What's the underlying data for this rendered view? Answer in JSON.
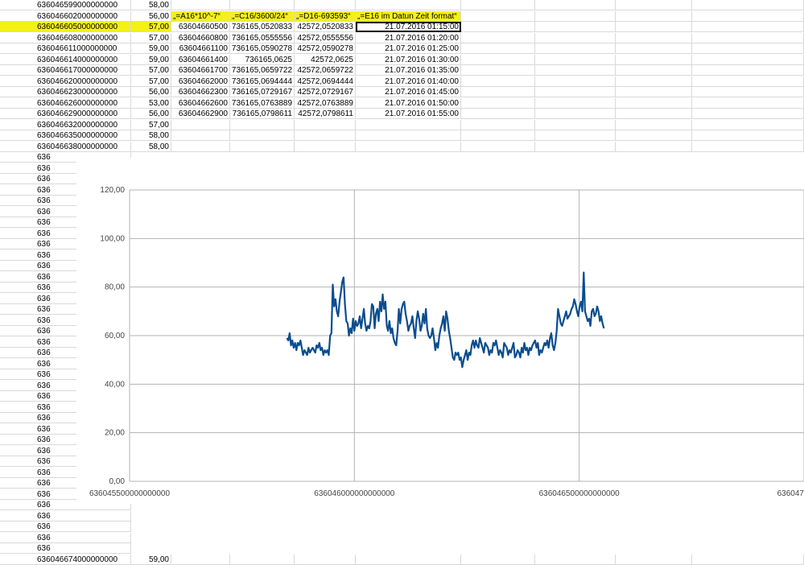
{
  "sheet": {
    "rows": [
      {
        "a": "636046599000000000",
        "b": "58,00"
      },
      {
        "a": "636046602000000000",
        "b": "56,00",
        "c": "„=A16*10^-7“",
        "d": "„=C16/3600/24“",
        "e": "„=D16-693593“",
        "f": "„=E16 im Datun Zeit format“",
        "header": true
      },
      {
        "a": "636046605000000000",
        "b": "57,00",
        "c": "63604660500",
        "d": "736165,0520833",
        "e": "42572,0520833",
        "f": "21.07.2016 01:15:00",
        "highlight": true
      },
      {
        "a": "636046608000000000",
        "b": "57,00",
        "c": "63604660800",
        "d": "736165,0555556",
        "e": "42572,0555556",
        "f": "21.07.2016 01:20:00"
      },
      {
        "a": "636046611000000000",
        "b": "59,00",
        "c": "63604661100",
        "d": "736165,0590278",
        "e": "42572,0590278",
        "f": "21.07.2016 01:25:00"
      },
      {
        "a": "636046614000000000",
        "b": "59,00",
        "c": "63604661400",
        "d": "736165,0625",
        "e": "42572,0625",
        "f": "21.07.2016 01:30:00"
      },
      {
        "a": "636046617000000000",
        "b": "57,00",
        "c": "63604661700",
        "d": "736165,0659722",
        "e": "42572,0659722",
        "f": "21.07.2016 01:35:00"
      },
      {
        "a": "636046620000000000",
        "b": "57,00",
        "c": "63604662000",
        "d": "736165,0694444",
        "e": "42572,0694444",
        "f": "21.07.2016 01:40:00"
      },
      {
        "a": "636046623000000000",
        "b": "56,00",
        "c": "63604662300",
        "d": "736165,0729167",
        "e": "42572,0729167",
        "f": "21.07.2016 01:45:00"
      },
      {
        "a": "636046626000000000",
        "b": "53,00",
        "c": "63604662600",
        "d": "736165,0763889",
        "e": "42572,0763889",
        "f": "21.07.2016 01:50:00"
      },
      {
        "a": "636046629000000000",
        "b": "56,00",
        "c": "63604662900",
        "d": "736165,0798611",
        "e": "42572,0798611",
        "f": "21.07.2016 01:55:00"
      },
      {
        "a": "636046632000000000",
        "b": "57,00"
      },
      {
        "a": "636046635000000000",
        "b": "58,00"
      },
      {
        "a": "636046638000000000",
        "b": "58,00"
      },
      {
        "a": "636"
      },
      {
        "a": "636"
      },
      {
        "a": "636"
      },
      {
        "a": "636"
      },
      {
        "a": "636"
      },
      {
        "a": "636"
      },
      {
        "a": "636"
      },
      {
        "a": "636"
      },
      {
        "a": "636"
      },
      {
        "a": "636"
      },
      {
        "a": "636"
      },
      {
        "a": "636"
      },
      {
        "a": "636"
      },
      {
        "a": "636"
      },
      {
        "a": "636"
      },
      {
        "a": "636"
      },
      {
        "a": "636"
      },
      {
        "a": "636"
      },
      {
        "a": "636"
      },
      {
        "a": "636"
      },
      {
        "a": "636"
      },
      {
        "a": "636"
      },
      {
        "a": "636"
      },
      {
        "a": "636"
      },
      {
        "a": "636"
      },
      {
        "a": "636"
      },
      {
        "a": "636"
      },
      {
        "a": "636"
      },
      {
        "a": "636"
      },
      {
        "a": "636"
      },
      {
        "a": "636"
      },
      {
        "a": "636"
      },
      {
        "a": "636"
      },
      {
        "a": "636"
      },
      {
        "a": "636"
      },
      {
        "a": "636"
      },
      {
        "a": "636"
      },
      {
        "a": "636046674000000000",
        "b": "59,00"
      }
    ],
    "highlight_color": "#f5f01a",
    "selected_cell": "F3"
  },
  "chart_data": {
    "type": "line",
    "title": "",
    "xlabel": "",
    "ylabel": "",
    "ylim": [
      0,
      120
    ],
    "yticks": [
      "0,00",
      "20,00",
      "40,00",
      "60,00",
      "80,00",
      "100,00",
      "120,00"
    ],
    "xlim": [
      636045500000000000,
      636047000000000000
    ],
    "xticks": [
      {
        "value": 636045500000000000,
        "label": "636045500000000000"
      },
      {
        "value": 636046000000000000,
        "label": "636046000000000000"
      },
      {
        "value": 636046500000000000,
        "label": "636046500000000000"
      },
      {
        "value": 636047000000000000,
        "label": "636047"
      }
    ],
    "grid": true,
    "line_color": "#0a4d8f",
    "x_start": 636045850000000000,
    "x_step": 3000000000,
    "series": [
      {
        "values": [
          59,
          58,
          61,
          56,
          58,
          55,
          57,
          54,
          57,
          56,
          58,
          55,
          52,
          54,
          53,
          52,
          55,
          53,
          54,
          55,
          54,
          53,
          56,
          55,
          57,
          54,
          55,
          52,
          54,
          53,
          54,
          52,
          60,
          61,
          81,
          72,
          75,
          70,
          68,
          74,
          78,
          82,
          84,
          73,
          66,
          65,
          60,
          63,
          61,
          67,
          62,
          66,
          64,
          65,
          68,
          63,
          67,
          71,
          65,
          62,
          64,
          63,
          66,
          73,
          72,
          63,
          69,
          71,
          66,
          74,
          70,
          77,
          71,
          74,
          64,
          62,
          66,
          61,
          63,
          59,
          57,
          56,
          62,
          71,
          65,
          71,
          73,
          74,
          69,
          66,
          62,
          64,
          65,
          68,
          63,
          59,
          66,
          70,
          67,
          62,
          64,
          69,
          65,
          71,
          63,
          60,
          59,
          60,
          63,
          59,
          54,
          57,
          55,
          60,
          63,
          65,
          68,
          62,
          70,
          67,
          62,
          59,
          55,
          51,
          50,
          53,
          52,
          53,
          50,
          51,
          47,
          50,
          52,
          54,
          50,
          53,
          52,
          56,
          58,
          55,
          58,
          56,
          55,
          59,
          57,
          55,
          53,
          57,
          56,
          55,
          52,
          54,
          53,
          57,
          56,
          58,
          55,
          52,
          54,
          53,
          51,
          57,
          56,
          55,
          52,
          54,
          53,
          55,
          57,
          51,
          52,
          54,
          53,
          51,
          55,
          53,
          57,
          54,
          55,
          52,
          55,
          54,
          56,
          57,
          58,
          55,
          57,
          52,
          54,
          53,
          55,
          57,
          56,
          58,
          55,
          59,
          61,
          56,
          54,
          57,
          62,
          71,
          68,
          65,
          64,
          66,
          68,
          70,
          67,
          68,
          69,
          71,
          72,
          75,
          73,
          70,
          68,
          72,
          74,
          70,
          86,
          70,
          68,
          66,
          67,
          64,
          70,
          71,
          68,
          69,
          72,
          70,
          66,
          68,
          65,
          63
        ]
      }
    ]
  }
}
